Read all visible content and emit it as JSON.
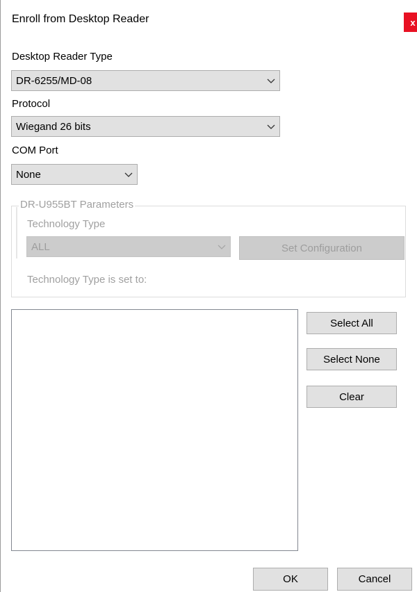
{
  "window": {
    "title": "Enroll from Desktop Reader",
    "close_glyph": "x"
  },
  "reader_type": {
    "label": "Desktop Reader Type",
    "value": "DR-6255/MD-08"
  },
  "protocol": {
    "label": "Protocol",
    "value": "Wiegand 26 bits"
  },
  "com_port": {
    "label": "COM Port",
    "value": "None"
  },
  "parameters_group": {
    "legend": "DR-U955BT Parameters",
    "tech_type_label": "Technology Type",
    "tech_type_value": "ALL",
    "set_config_button": "Set Configuration",
    "tech_type_status": "Technology Type is set to:"
  },
  "list_actions": {
    "select_all": "Select All",
    "select_none": "Select None",
    "clear": "Clear"
  },
  "footer": {
    "ok": "OK",
    "cancel": "Cancel"
  },
  "icons": {
    "dropdown": "chevron-down-icon",
    "close": "close-icon"
  },
  "colors": {
    "close_button": "#e81123",
    "button_face": "#e1e1e1",
    "disabled_text": "#a0a0a0"
  }
}
